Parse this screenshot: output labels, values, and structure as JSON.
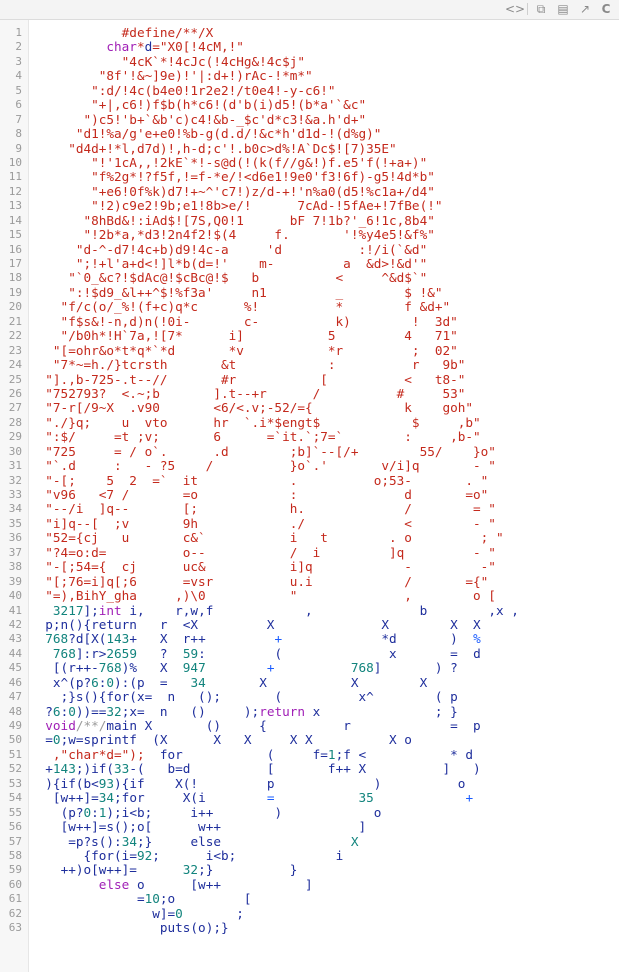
{
  "toolbar": {
    "icons": [
      {
        "name": "code-icon",
        "glyph": "<>"
      },
      {
        "name": "copy-icon",
        "glyph": "⧉"
      },
      {
        "name": "raw-icon",
        "glyph": "▤"
      },
      {
        "name": "external-link-icon",
        "glyph": "↗"
      },
      {
        "name": "c-language-icon",
        "glyph": "C"
      }
    ]
  },
  "colors": {
    "string": "#c4291c",
    "keyword": "#a01fb6",
    "identifier": "#1e2e9c",
    "number": "#12847d",
    "operator_blue": "#1a5cff",
    "comment": "#9a9a9a",
    "line_number": "#9a9a9a"
  },
  "lines": [
    {
      "n": "1",
      "parts": [
        {
          "t": "            #define/**/X",
          "c": ""
        }
      ]
    },
    {
      "n": "2",
      "parts": [
        {
          "t": "          ",
          "c": ""
        },
        {
          "t": "char",
          "c": "kw"
        },
        {
          "t": "*",
          "c": ""
        },
        {
          "t": "d",
          "c": "id"
        },
        {
          "t": "=\"X0[!4cM,!\"",
          "c": ""
        }
      ]
    },
    {
      "n": "3",
      "parts": [
        {
          "t": "            \"4cK`*!4cJc(!4cHg&!4c$j\"",
          "c": ""
        }
      ]
    },
    {
      "n": "4",
      "parts": [
        {
          "t": "         \"8f'!&~]9e)!'|:d+!)rAc-!*m*\"",
          "c": ""
        }
      ]
    },
    {
      "n": "5",
      "parts": [
        {
          "t": "        \":d/!4c(b4e0!1r2e2!/t0e4!-y-c6!\"",
          "c": ""
        }
      ]
    },
    {
      "n": "6",
      "parts": [
        {
          "t": "        \"+|,c6!)f$b(h*c6!(d'b(i)d5!(b*a'`&c\"",
          "c": ""
        }
      ]
    },
    {
      "n": "7",
      "parts": [
        {
          "t": "       \")c5!'b+`&b'c)c4!&b-_$c'd*c3!&a.h'd+\"",
          "c": ""
        }
      ]
    },
    {
      "n": "8",
      "parts": [
        {
          "t": "      \"d1!%a/g'e+e0!%b-g(d.d/!&c*h'd1d-!(d%g)\"",
          "c": ""
        }
      ]
    },
    {
      "n": "9",
      "parts": [
        {
          "t": "     \"d4d+!*l,d7d)!,h-d;c'!.b0c>d%!A`Dc$![7)35E\"",
          "c": ""
        }
      ]
    },
    {
      "n": "10",
      "parts": [
        {
          "t": "        \"!'1cA,,!2kE`*!-s@d(!(k(f//g&!)f.e5'f(!+a+)\"",
          "c": ""
        }
      ]
    },
    {
      "n": "11",
      "parts": [
        {
          "t": "        \"f%2g*!?f5f,!=f-*e/!<d6e1!9e0'f3!6f)-g5!4d*b\"",
          "c": ""
        }
      ]
    },
    {
      "n": "12",
      "parts": [
        {
          "t": "        \"+e6!0f%k)d7!+~^'c7!)z/d-+!'n%a0(d5!%c1a+/d4\"",
          "c": ""
        }
      ]
    },
    {
      "n": "13",
      "parts": [
        {
          "t": "        \"!2)c9e2!9b;e1!8b>e/!      7cAd-!5fAe+!7fBe(!\"",
          "c": ""
        }
      ]
    },
    {
      "n": "14",
      "parts": [
        {
          "t": "       \"8hBd&!:iAd$![7S,Q0!1      bF 7!1b?'_6!1c,8b4\"",
          "c": ""
        }
      ]
    },
    {
      "n": "15",
      "parts": [
        {
          "t": "       \"!2b*a,*d3!2n4f2!$(4     f.       '!%y4e5!&f%\"",
          "c": ""
        }
      ]
    },
    {
      "n": "16",
      "parts": [
        {
          "t": "      \"d-^-d7!4c+b)d9!4c-a     'd          :!/i(`&d\"",
          "c": ""
        }
      ]
    },
    {
      "n": "17",
      "parts": [
        {
          "t": "      \";!+l'a+d<!]l*b(d=!'    m-         a  &d>!&d'\"",
          "c": ""
        }
      ]
    },
    {
      "n": "18",
      "parts": [
        {
          "t": "     \"`0_&c?!$dAc@!$cBc@!$   b          <     ^&d$`\"",
          "c": ""
        }
      ]
    },
    {
      "n": "19",
      "parts": [
        {
          "t": "     \":!$d9_&l++^$!%f3a'     n1         _        $ !&\"",
          "c": ""
        }
      ]
    },
    {
      "n": "20",
      "parts": [
        {
          "t": "    \"f/c(o/_%!(f+c)q*c      %!          *        f &d+\"",
          "c": ""
        }
      ]
    },
    {
      "n": "21",
      "parts": [
        {
          "t": "    \"f$s&!-n,d)n(!0i-       c-          k)        !  3d\"",
          "c": ""
        }
      ]
    },
    {
      "n": "22",
      "parts": [
        {
          "t": "    \"/b0h*!H`7a,![7*      i]           5         4   71\"",
          "c": ""
        }
      ]
    },
    {
      "n": "23",
      "parts": [
        {
          "t": "   \"[=ohr&o*t*q*`*d       *v           *r         ;  02\"",
          "c": ""
        }
      ]
    },
    {
      "n": "24",
      "parts": [
        {
          "t": "   \"7*~=h./}tcrsth       &t            :          r   9b\"",
          "c": ""
        }
      ]
    },
    {
      "n": "25",
      "parts": [
        {
          "t": "  \"].,b-725-.t--//       #r           [          <   t8-\"",
          "c": ""
        }
      ]
    },
    {
      "n": "26",
      "parts": [
        {
          "t": "  \"752793?  <.~;b       ].t--+r      /          #     53\"",
          "c": ""
        }
      ]
    },
    {
      "n": "27",
      "parts": [
        {
          "t": "  \"7-r[/9~X  .v90       <6/<.v;-52/={            k    goh\"",
          "c": ""
        }
      ]
    },
    {
      "n": "28",
      "parts": [
        {
          "t": "  \"./}q;    u  vto      hr  `.i*$engt$            $     ,b\"",
          "c": ""
        }
      ]
    },
    {
      "n": "29",
      "parts": [
        {
          "t": "  \":$/     =t ;v;       6      =`it.`;7=`        :     ,b-\"",
          "c": ""
        }
      ]
    },
    {
      "n": "30",
      "parts": [
        {
          "t": "  \"725     = / o`.      .d        ;b]`--[/+        55/    }o\"",
          "c": ""
        }
      ]
    },
    {
      "n": "31",
      "parts": [
        {
          "t": "  \"`.d     :   - ?5    /          }o`.'       v/i]q       - \"",
          "c": ""
        }
      ]
    },
    {
      "n": "32",
      "parts": [
        {
          "t": "  \"-[;    5  2  =`  it            .          o;53-       . \"",
          "c": ""
        }
      ]
    },
    {
      "n": "33",
      "parts": [
        {
          "t": "  \"v96   <7 /       =o            :              d       =o\"",
          "c": ""
        }
      ]
    },
    {
      "n": "34",
      "parts": [
        {
          "t": "  \"--/i  ]q--       [;            h.             /        = \"",
          "c": ""
        }
      ]
    },
    {
      "n": "35",
      "parts": [
        {
          "t": "  \"i]q--[  ;v       9h            ./             <        - \"",
          "c": ""
        }
      ]
    },
    {
      "n": "36",
      "parts": [
        {
          "t": "  \"52={cj   u       c&`           i   t        . o         ; \"",
          "c": ""
        }
      ]
    },
    {
      "n": "37",
      "parts": [
        {
          "t": "  \"?4=o:d=          o--           /  i         ]q         - \"",
          "c": ""
        }
      ]
    },
    {
      "n": "38",
      "parts": [
        {
          "t": "  \"-[;54={  cj      uc&           i]q            -         -\"",
          "c": ""
        }
      ]
    },
    {
      "n": "39",
      "parts": [
        {
          "t": "  \"[;76=i]q[;6      =vsr          u.i            /       ={\"",
          "c": ""
        }
      ]
    },
    {
      "n": "40",
      "parts": [
        {
          "t": "  \"=),BihY_gha     ,)\\0           \"              ,        o [",
          "c": ""
        }
      ]
    },
    {
      "n": "41",
      "parts": [
        {
          "t": "   ",
          "c": ""
        },
        {
          "t": "3217",
          "c": "num"
        },
        {
          "t": "];",
          "c": "id"
        },
        {
          "t": "int",
          "c": "kw"
        },
        {
          "t": " i,    r,w,f            ,              b        ,x ,",
          "c": "id"
        }
      ]
    },
    {
      "n": "42",
      "parts": [
        {
          "t": "  ",
          "c": ""
        },
        {
          "t": "p;n(){return   r  <X         X              X        X  X",
          "c": "id"
        }
      ]
    },
    {
      "n": "43",
      "parts": [
        {
          "t": "  ",
          "c": ""
        },
        {
          "t": "768",
          "c": "num"
        },
        {
          "t": "?d[X(",
          "c": "id"
        },
        {
          "t": "143",
          "c": "num"
        },
        {
          "t": "+   X  r++         ",
          "c": "id"
        },
        {
          "t": "+",
          "c": "blu"
        },
        {
          "t": "             *d       )  ",
          "c": "id"
        },
        {
          "t": "%",
          "c": "blu"
        }
      ]
    },
    {
      "n": "44",
      "parts": [
        {
          "t": "   ",
          "c": ""
        },
        {
          "t": "768",
          "c": "num"
        },
        {
          "t": "]:r>",
          "c": "id"
        },
        {
          "t": "2659",
          "c": "num"
        },
        {
          "t": "   ?  ",
          "c": "id"
        },
        {
          "t": "59",
          "c": "num"
        },
        {
          "t": ":         (              x       =  d",
          "c": "id"
        }
      ]
    },
    {
      "n": "45",
      "parts": [
        {
          "t": "   ",
          "c": ""
        },
        {
          "t": "[(r++-",
          "c": "id"
        },
        {
          "t": "768",
          "c": "num"
        },
        {
          "t": ")%   X  ",
          "c": "id"
        },
        {
          "t": "947",
          "c": "num"
        },
        {
          "t": "        ",
          "c": "id"
        },
        {
          "t": "+",
          "c": "blu"
        },
        {
          "t": "          ",
          "c": "id"
        },
        {
          "t": "768",
          "c": "num"
        },
        {
          "t": "]       ) ?",
          "c": "id"
        }
      ]
    },
    {
      "n": "46",
      "parts": [
        {
          "t": "   ",
          "c": ""
        },
        {
          "t": "x^(p?",
          "c": "id"
        },
        {
          "t": "6",
          "c": "num"
        },
        {
          "t": ":",
          "c": "id"
        },
        {
          "t": "0",
          "c": "num"
        },
        {
          "t": "):(p  =   ",
          "c": "id"
        },
        {
          "t": "34",
          "c": "num"
        },
        {
          "t": "       X           X        X",
          "c": "id"
        }
      ]
    },
    {
      "n": "47",
      "parts": [
        {
          "t": "    ",
          "c": ""
        },
        {
          "t": ";}s(){for(x=  n   ();       (          x^        ( p",
          "c": "id"
        }
      ]
    },
    {
      "n": "48",
      "parts": [
        {
          "t": "  ",
          "c": ""
        },
        {
          "t": "?",
          "c": "id"
        },
        {
          "t": "6",
          "c": "num"
        },
        {
          "t": ":",
          "c": "id"
        },
        {
          "t": "0",
          "c": "num"
        },
        {
          "t": "))==",
          "c": "id"
        },
        {
          "t": "32",
          "c": "num"
        },
        {
          "t": ";x=  n   ()     );",
          "c": "id"
        },
        {
          "t": "return",
          "c": "kw"
        },
        {
          "t": " x               ; }",
          "c": "id"
        }
      ]
    },
    {
      "n": "49",
      "parts": [
        {
          "t": "  ",
          "c": ""
        },
        {
          "t": "void",
          "c": "kw"
        },
        {
          "t": "/**/",
          "c": "cmt"
        },
        {
          "t": "main X       ()     {          r             =  p",
          "c": "id"
        }
      ]
    },
    {
      "n": "50",
      "parts": [
        {
          "t": "  ",
          "c": ""
        },
        {
          "t": "=",
          "c": "id"
        },
        {
          "t": "0",
          "c": "num"
        },
        {
          "t": ";w=sprintf  (X      X   X     X X          X o",
          "c": "id"
        }
      ]
    },
    {
      "n": "51",
      "parts": [
        {
          "t": "   ",
          "c": ""
        },
        {
          "t": ",\"char*d=\");",
          "c": ""
        },
        {
          "t": "  for           (     f=",
          "c": "id"
        },
        {
          "t": "1",
          "c": "num"
        },
        {
          "t": ";f <           * d",
          "c": "id"
        }
      ]
    },
    {
      "n": "52",
      "parts": [
        {
          "t": "  ",
          "c": ""
        },
        {
          "t": "+",
          "c": "id"
        },
        {
          "t": "143",
          "c": "num"
        },
        {
          "t": ";)if(",
          "c": "id"
        },
        {
          "t": "33",
          "c": "num"
        },
        {
          "t": "-(   b=d          [       f++ X          ]   )",
          "c": "id"
        }
      ]
    },
    {
      "n": "53",
      "parts": [
        {
          "t": "  ",
          "c": ""
        },
        {
          "t": "){if(b<",
          "c": "id"
        },
        {
          "t": "93",
          "c": "num"
        },
        {
          "t": "){if    X(!         p             )          o",
          "c": "id"
        }
      ]
    },
    {
      "n": "54",
      "parts": [
        {
          "t": "   ",
          "c": ""
        },
        {
          "t": "[w++]=",
          "c": "id"
        },
        {
          "t": "34",
          "c": "num"
        },
        {
          "t": ";for     X(i        ",
          "c": "id"
        },
        {
          "t": "=",
          "c": "blu"
        },
        {
          "t": "           ",
          "c": "id"
        },
        {
          "t": "35",
          "c": "num"
        },
        {
          "t": "            ",
          "c": "id"
        },
        {
          "t": "+",
          "c": "blu"
        }
      ]
    },
    {
      "n": "55",
      "parts": [
        {
          "t": "    ",
          "c": ""
        },
        {
          "t": "(p?",
          "c": "id"
        },
        {
          "t": "0",
          "c": "num"
        },
        {
          "t": ":",
          "c": "id"
        },
        {
          "t": "1",
          "c": "num"
        },
        {
          "t": ");i<b;     i++        )            o",
          "c": "id"
        }
      ]
    },
    {
      "n": "56",
      "parts": [
        {
          "t": "    ",
          "c": ""
        },
        {
          "t": "[w++]=s();o[      w++                  ]",
          "c": "id"
        }
      ]
    },
    {
      "n": "57",
      "parts": [
        {
          "t": "     ",
          "c": ""
        },
        {
          "t": "=p?s():",
          "c": "id"
        },
        {
          "t": "34",
          "c": "num"
        },
        {
          "t": ";}     else",
          "c": "id"
        },
        {
          "t": "                 X",
          "c": "num"
        }
      ]
    },
    {
      "n": "58",
      "parts": [
        {
          "t": "       ",
          "c": ""
        },
        {
          "t": "{for(i=",
          "c": "id"
        },
        {
          "t": "92",
          "c": "num"
        },
        {
          "t": ";      i<b;             i",
          "c": "id"
        }
      ]
    },
    {
      "n": "59",
      "parts": [
        {
          "t": "    ",
          "c": ""
        },
        {
          "t": "++)o[w++]=      ",
          "c": "id"
        },
        {
          "t": "32",
          "c": "num"
        },
        {
          "t": ";}          }",
          "c": "id"
        }
      ]
    },
    {
      "n": "60",
      "parts": [
        {
          "t": "         ",
          "c": ""
        },
        {
          "t": "else",
          "c": "kw"
        },
        {
          "t": " o      [w++           ]",
          "c": "id"
        }
      ]
    },
    {
      "n": "61",
      "parts": [
        {
          "t": "              ",
          "c": ""
        },
        {
          "t": "=",
          "c": "id"
        },
        {
          "t": "10",
          "c": "num"
        },
        {
          "t": ";o         [",
          "c": "id"
        }
      ]
    },
    {
      "n": "62",
      "parts": [
        {
          "t": "                ",
          "c": ""
        },
        {
          "t": "w]=",
          "c": "id"
        },
        {
          "t": "0",
          "c": "num"
        },
        {
          "t": "       ;",
          "c": "id"
        }
      ]
    },
    {
      "n": "63",
      "parts": [
        {
          "t": "                 ",
          "c": ""
        },
        {
          "t": "puts(o);}",
          "c": "id"
        }
      ]
    }
  ]
}
